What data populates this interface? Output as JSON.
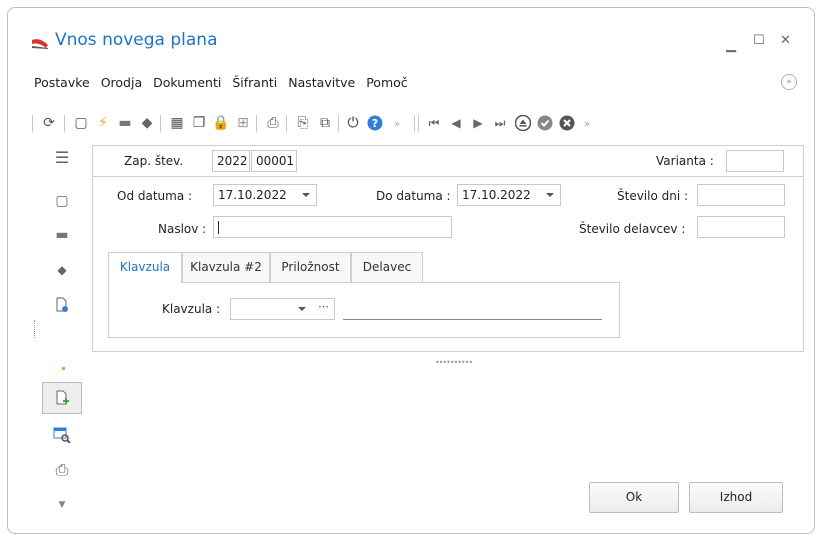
{
  "window": {
    "title": "Vnos novega plana"
  },
  "menu": [
    "Postavke",
    "Orodja",
    "Dokumenti",
    "Šifranti",
    "Nastavitve",
    "Pomoč"
  ],
  "form": {
    "zap_label": "Zap. štev.",
    "zap_year": "2022",
    "zap_num": "00001",
    "varianta_label": "Varianta :",
    "varianta_value": "",
    "od_label": "Od datuma :",
    "od_value": "17.10.2022",
    "do_label": "Do datuma :",
    "do_value": "17.10.2022",
    "dni_label": "Število dni :",
    "dni_value": "",
    "naslov_label": "Naslov :",
    "naslov_value": "",
    "delavcev_label": "Število delavcev :",
    "delavcev_value": ""
  },
  "tabs": [
    "Klavzula",
    "Klavzula #2",
    "Priložnost",
    "Delavec"
  ],
  "tab_panel": {
    "klavzula_label": "Klavzula :",
    "klavzula_value": "",
    "klavzula_text": ""
  },
  "buttons": {
    "ok": "Ok",
    "exit": "Izhod"
  },
  "colors": {
    "accent": "#1e73c8",
    "green": "#3aa64a",
    "orange": "#f0a020"
  }
}
